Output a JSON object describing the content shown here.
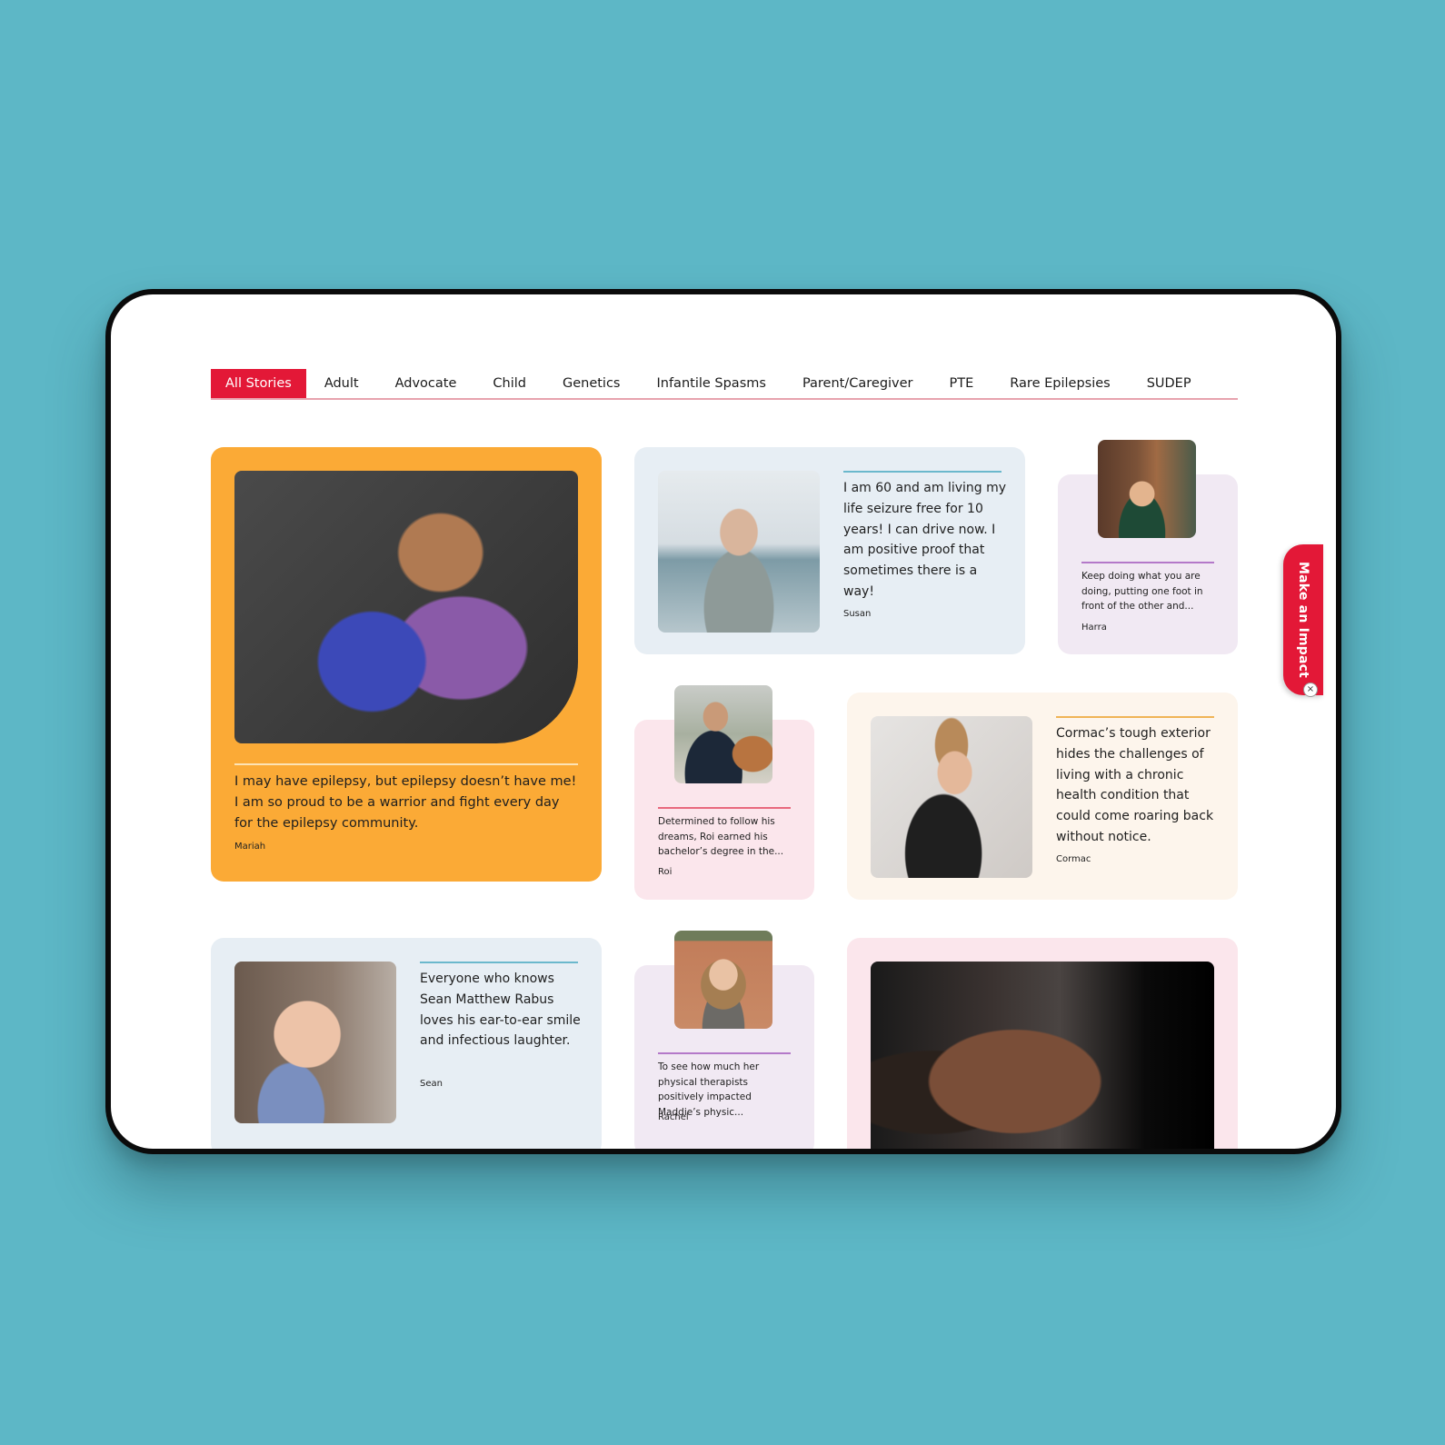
{
  "tabs": [
    {
      "label": "All Stories",
      "active": true
    },
    {
      "label": "Adult",
      "active": false
    },
    {
      "label": "Advocate",
      "active": false
    },
    {
      "label": "Child",
      "active": false
    },
    {
      "label": "Genetics",
      "active": false
    },
    {
      "label": "Infantile Spasms",
      "active": false
    },
    {
      "label": "Parent/Caregiver",
      "active": false
    },
    {
      "label": "PTE",
      "active": false
    },
    {
      "label": "Rare Epilepsies",
      "active": false
    },
    {
      "label": "SUDEP",
      "active": false
    }
  ],
  "stories": [
    {
      "author": "Mariah",
      "quote": "I may have epilepsy, but epilepsy doesn’t have me! I am so proud to be a warrior and fight every day for the epilepsy community.",
      "photo": "woman-with-sash-reading-book-photo"
    },
    {
      "author": "Susan",
      "quote": "I am 60 and am living my life seizure free for 10 years! I can drive now. I am positive proof that sometimes there is a way!",
      "photo": "woman-at-beach-photo"
    },
    {
      "author": "Harra",
      "quote": "Keep doing what you are doing, putting one foot in front of the other and...",
      "photo": "boy-in-green-shirt-photo"
    },
    {
      "author": "Roi",
      "quote": "Determined to follow his dreams, Roi earned his bachelor’s degree in the...",
      "photo": "young-man-with-violin-photo"
    },
    {
      "author": "Cormac",
      "quote": "Cormac’s tough exterior hides the challenges of living with a chronic health condition that could come roaring back without notice.",
      "photo": "boy-with-eeg-electrodes-photo"
    },
    {
      "author": "Sean",
      "quote": "Everyone who knows Sean Matthew Rabus loves his ear-to-ear smile and infectious laughter.",
      "photo": "smiling-toddler-photo"
    },
    {
      "author": "Rachel",
      "quote": "To see how much her physical therapists positively impacted Maddie’s physic...",
      "photo": "smiling-young-woman-photo"
    },
    {
      "author": "",
      "quote": "",
      "photo": "older-woman-portrait-photo"
    }
  ],
  "impact_tab": {
    "label": "Make an Impact",
    "close": "×"
  },
  "colors": {
    "accent": "#e31837",
    "orange_card": "#fbaa36",
    "blue_card": "#e7eef4",
    "lavender_card": "#f1e9f3",
    "pink_card": "#fbe6ec",
    "cream_card": "#fdf5ec"
  }
}
